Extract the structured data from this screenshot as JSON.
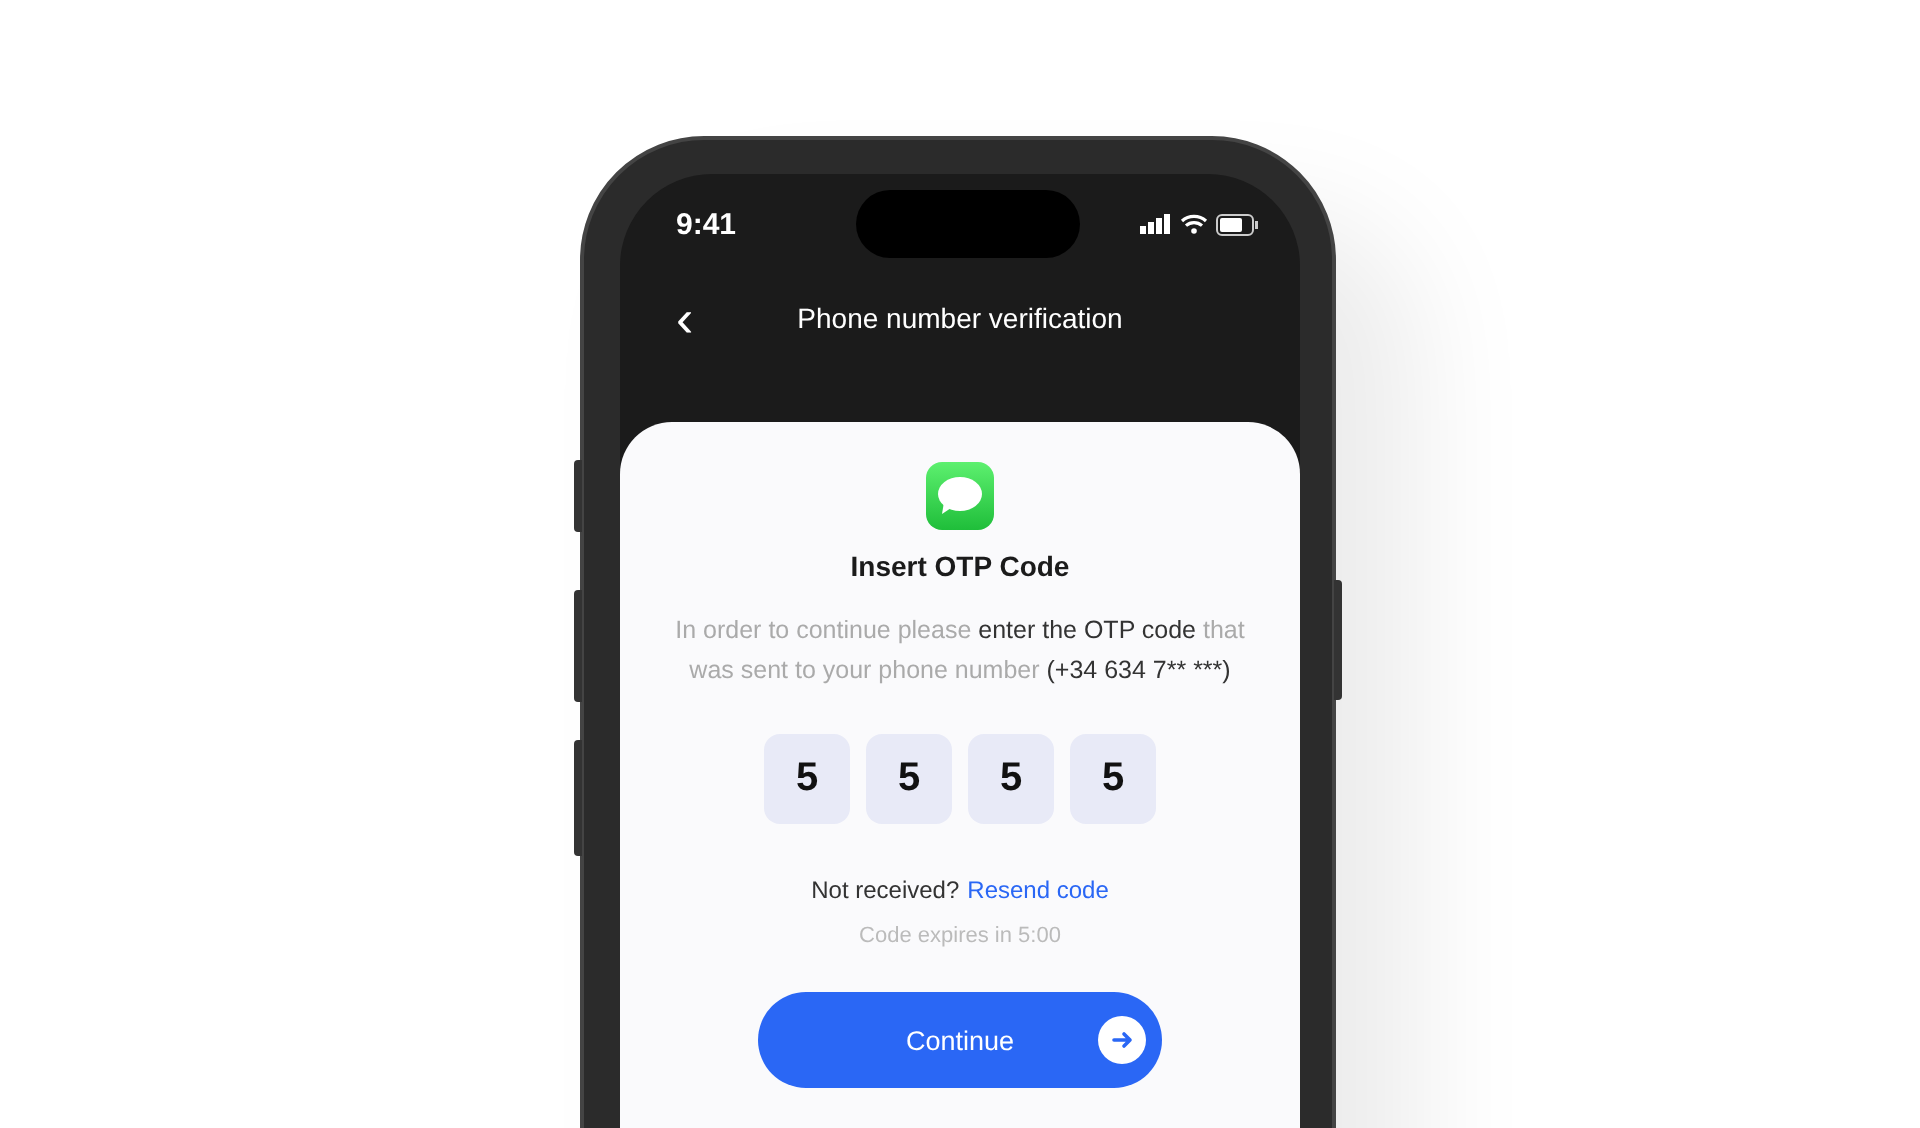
{
  "status_bar": {
    "time": "9:41"
  },
  "header": {
    "back": "‹",
    "title": "Phone number verification"
  },
  "card": {
    "title": "Insert OTP Code",
    "description": [
      {
        "text": "In order to continue please ",
        "emphasis": false
      },
      {
        "text": "enter the OTP code",
        "emphasis": true
      },
      {
        "text": " that was sent to your phone number  ",
        "emphasis": false
      },
      {
        "text": "(+34 634 7** ***)",
        "emphasis": true
      }
    ],
    "otp_digits": [
      "5",
      "5",
      "5",
      "5"
    ],
    "resend": {
      "prompt": "Not received?",
      "link": "Resend code"
    },
    "expiry": "Code expires in 5:00",
    "button": {
      "label": "Continue"
    }
  }
}
